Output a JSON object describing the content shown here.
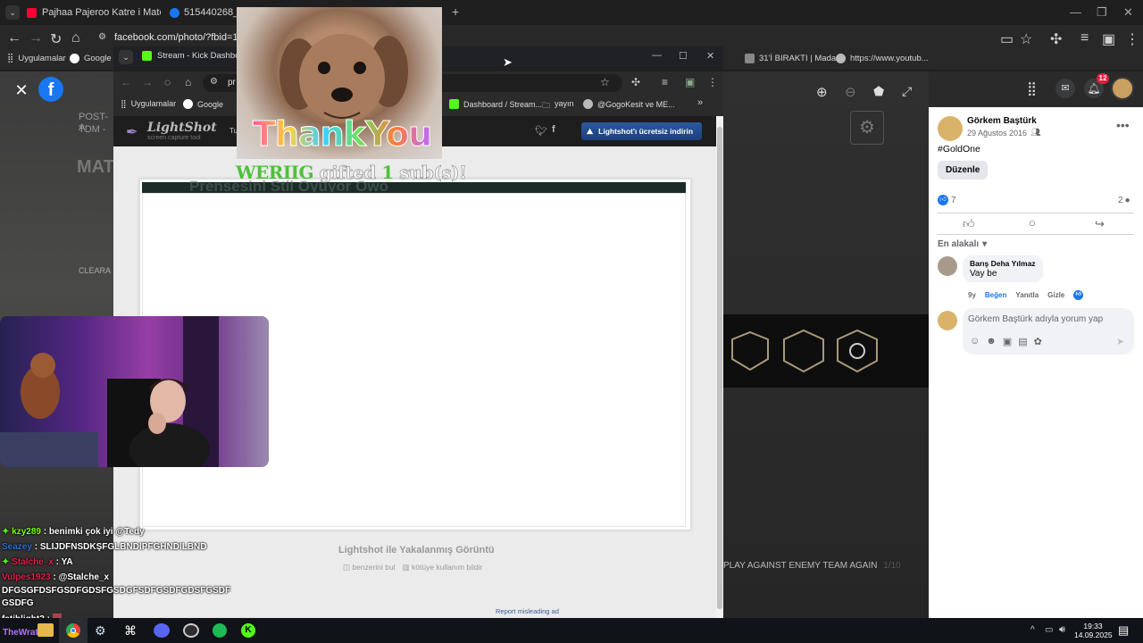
{
  "browser": {
    "tabs": [
      {
        "title": "Pajhaa Pajeroo Katre i Matem 7",
        "color": "#ff0033"
      },
      {
        "title": "515440268_3134",
        "color": "#1877f2"
      }
    ],
    "new_tab": "+",
    "url": "facebook.com/photo/?fbid=1527",
    "bookmarks": [
      {
        "label": "Uygulamalar"
      },
      {
        "label": "Google"
      },
      {
        "label": "31'İ BIRAKTI | Mada..."
      },
      {
        "label": "https://www.youtub..."
      }
    ]
  },
  "kick_window": {
    "tab_title": "Stream - Kick Dashboard",
    "url_fragment": "pr",
    "bookmarks": [
      {
        "label": "Uygulamalar"
      },
      {
        "label": "Google"
      },
      {
        "label": "Dashboard / Stream..."
      },
      {
        "label": "yayın"
      },
      {
        "label": "@GogoKesit ve ME..."
      }
    ]
  },
  "lightshot": {
    "logo": "LightShot",
    "logo_sub": "screen capture tool",
    "nav_fragment": "Tu",
    "download_button": "Lightshot'ı ücretsiz indirin",
    "caption_title": "Lightshot ile Yakalanmış Görüntü",
    "similar_link": "benzerini bul",
    "report_link": "kötüye kullanım bildir",
    "report_ad": "Report misleading ad"
  },
  "overlay": {
    "thank_you": "ThankYou",
    "gift_user": "WERIIG",
    "gift_text1": "gifted",
    "gift_count": "1",
    "gift_text2": "sub(s)!",
    "faded_title": "Prensesinl Stil Oyuyor Owo"
  },
  "fb_photo": {
    "left_text1": "POST-A",
    "left_text2": "TDM -",
    "left_text3": "MAT",
    "left_text4": "CLEARA",
    "right_text": "PLAY AGAINST ENEMY TEAM AGAIN",
    "right_count": "1/10"
  },
  "fb_header": {
    "notifications_count": "12"
  },
  "fb_post": {
    "author": "Görkem Baştürk",
    "date": "29 Ağustos 2016",
    "caption": "#GoldOne",
    "edit_button": "Düzenle",
    "likes": "7",
    "comments": "2",
    "sort_label": "En alakalı",
    "comment": {
      "author": "Barış Deha Yılmaz",
      "text": "Vay be",
      "age": "9y",
      "like": "Beğen",
      "reply": "Yanıtla",
      "hide": "Gizle"
    },
    "comment_placeholder": "Görkem Baştürk adıyla yorum yap"
  },
  "chat": [
    {
      "user": "kzy289",
      "msg": "benimki çok iyi @Tedy",
      "color": "#7CFC00",
      "badge": true
    },
    {
      "user": "Seazey",
      "msg": "SLIJDFNSDKŞFGLBNDIPFGHNDILBND",
      "color": "#2f6fd0",
      "badge": false
    },
    {
      "user": "Stalche_x",
      "msg": "YA",
      "color": "#e0204a",
      "badge": true
    },
    {
      "user": "Vulpes1923",
      "msg": "@Stalche_x",
      "color": "#e0204a",
      "badge": false
    }
  ],
  "chat_continuation": [
    "DFGSGFDSFGSDFGDSFGSDGFSDFGSDFGDSFGSDF",
    "GSDFG"
  ],
  "chat_last": {
    "user": "fatihlight2",
    "msg": ""
  },
  "taskbar": {
    "streamer": "TheWrat",
    "time": "19:33",
    "date": "14.09.2025"
  }
}
